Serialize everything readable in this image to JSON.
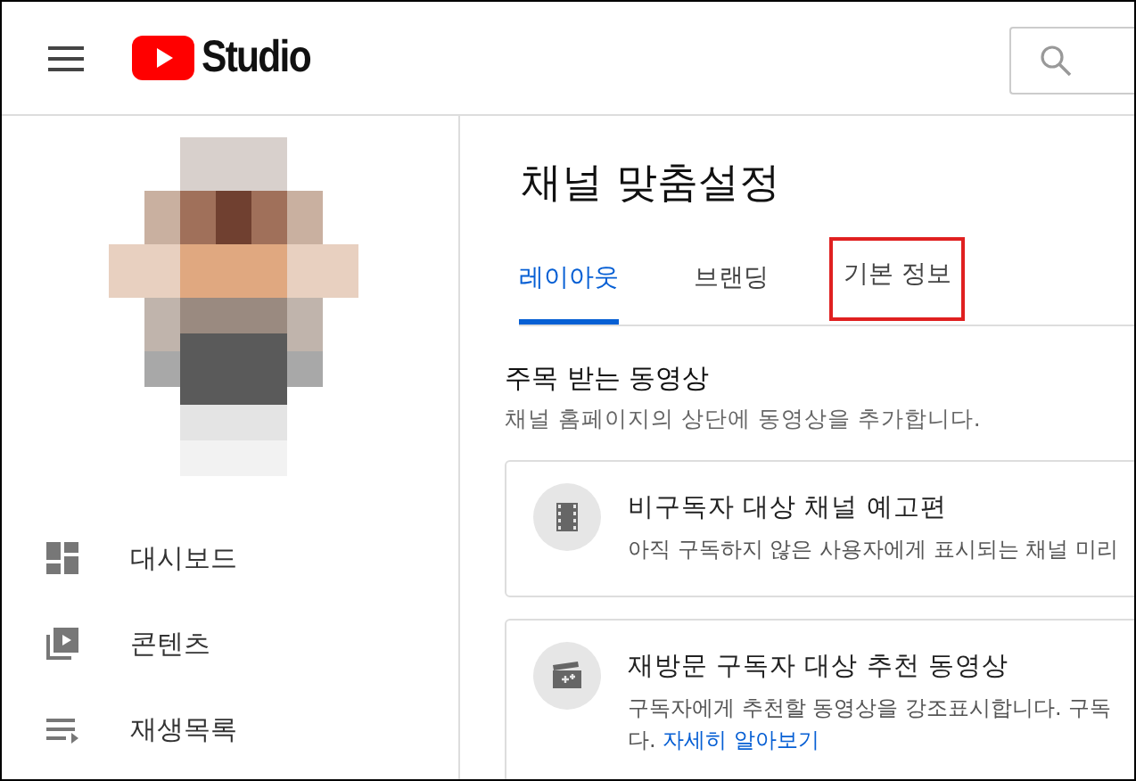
{
  "header": {
    "logo": "Studio"
  },
  "sidebar": {
    "items": [
      {
        "label": "대시보드"
      },
      {
        "label": "콘텐츠"
      },
      {
        "label": "재생목록"
      }
    ]
  },
  "main": {
    "title": "채널 맞춤설정",
    "tabs": [
      {
        "label": "레이아웃",
        "selected": true,
        "highlighted": false
      },
      {
        "label": "브랜딩",
        "selected": false,
        "highlighted": false
      },
      {
        "label": "기본 정보",
        "selected": false,
        "highlighted": true
      }
    ],
    "section": {
      "title": "주목 받는 동영상",
      "description": "채널 홈페이지의 상단에 동영상을 추가합니다.",
      "cards": [
        {
          "title": "비구독자 대상 채널 예고편",
          "lines": [
            "아직 구독하지 않은 사용자에게 표시되는 채널 미리"
          ]
        },
        {
          "title": "재방문 구독자 대상 추천 동영상",
          "lines": [
            "구독자에게 추천할 동영상을 강조표시합니다. 구독",
            "다."
          ],
          "link": "자세히 알아보기"
        }
      ]
    }
  }
}
